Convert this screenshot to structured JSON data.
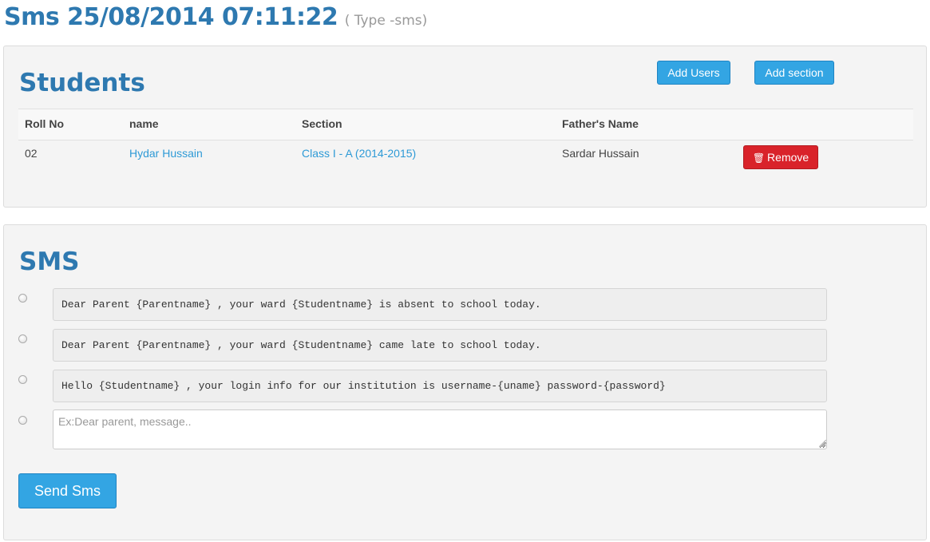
{
  "header": {
    "title": "Sms 25/08/2014 07:11:22",
    "type_label": "( Type -sms)"
  },
  "students": {
    "title": "Students",
    "add_users_label": "Add Users",
    "add_section_label": "Add section",
    "columns": [
      "Roll No",
      "name",
      "Section",
      "Father's Name"
    ],
    "rows": [
      {
        "roll_no": "02",
        "name": "Hydar Hussain",
        "section": "Class I - A (2014-2015)",
        "father_name": "Sardar Hussain",
        "remove_label": "Remove"
      }
    ]
  },
  "sms": {
    "title": "SMS",
    "templates": [
      "Dear Parent {Parentname} , your ward {Studentname} is absent to school today.",
      "Dear Parent {Parentname} , your ward {Studentname} came late to school today.",
      "Hello {Studentname} , your login info for our institution is username-{uname} password-{password}"
    ],
    "custom_placeholder": "Ex:Dear parent, message..",
    "send_label": "Send Sms"
  },
  "colors": {
    "heading": "#2e79b0",
    "primary_button": "#33a5e3",
    "danger_button": "#d9232a",
    "link": "#2e9ad6"
  },
  "icons": {
    "remove": "trash-icon"
  }
}
